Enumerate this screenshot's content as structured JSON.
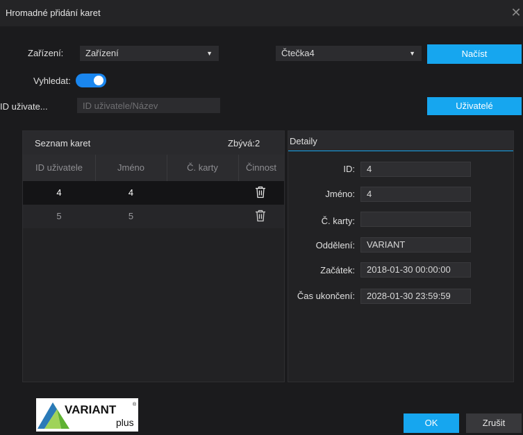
{
  "window": {
    "title": "Hromadné přidání karet",
    "close_glyph": "✕"
  },
  "top": {
    "device_label": "Zařízení:",
    "device_select": "Zařízení",
    "reader_select": "Čtečka4",
    "load_button": "Načíst",
    "search_label": "Vyhledat:",
    "search_toggle_on": true,
    "user_id_label": "ID uživate...",
    "user_id_placeholder": "ID uživatele/Název",
    "users_button": "Uživatelé"
  },
  "card_list": {
    "title": "Seznam karet",
    "remaining": "Zbývá:2",
    "columns": [
      "ID uživatele",
      "Jméno",
      "Č. karty",
      "Činnost"
    ],
    "rows": [
      {
        "id": "4",
        "name": "4",
        "card": ""
      },
      {
        "id": "5",
        "name": "5",
        "card": ""
      }
    ],
    "action_icon": "trash-icon"
  },
  "details": {
    "title": "Detaily",
    "fields": [
      {
        "label": "ID:",
        "value": "4"
      },
      {
        "label": "Jméno:",
        "value": "4"
      },
      {
        "label": "Č. karty:",
        "value": ""
      },
      {
        "label": "Oddělení:",
        "value": "VARIANT"
      },
      {
        "label": "Začátek:",
        "value": "2018-01-30 00:00:00"
      },
      {
        "label": "Čas ukončení:",
        "value": "2028-01-30 23:59:59"
      }
    ]
  },
  "footer": {
    "ok_button": "OK",
    "cancel_button": "Zrušit"
  },
  "logo": {
    "brand": "VARIANT",
    "sub": "plus",
    "mark": "®"
  },
  "colors": {
    "accent": "#16a6ef",
    "background": "#1b1b1d",
    "panel": "#222224"
  }
}
